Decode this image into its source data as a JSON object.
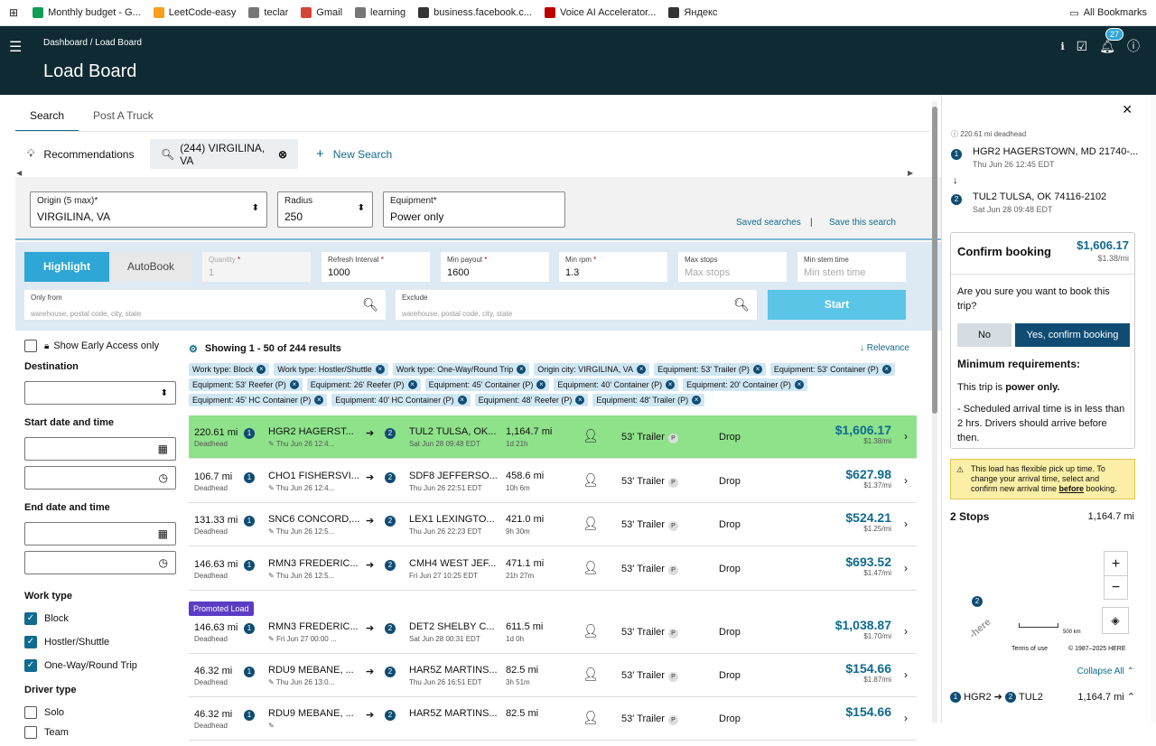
{
  "bookmarks": {
    "items": [
      {
        "label": "Monthly budget - G...",
        "icon": "sheets-icon",
        "color": "#0f9d58"
      },
      {
        "label": "LeetCode-easy",
        "icon": "leetcode-icon",
        "color": "#f89f1b"
      },
      {
        "label": "teclar",
        "icon": "folder-icon",
        "color": "#777"
      },
      {
        "label": "Gmail",
        "icon": "gmail-icon",
        "color": "#d44638"
      },
      {
        "label": "learning",
        "icon": "folder-icon",
        "color": "#777"
      },
      {
        "label": "business.facebook.c...",
        "icon": "globe-icon",
        "color": "#333"
      },
      {
        "label": "Voice AI Accelerator...",
        "icon": "sk-icon",
        "color": "#b00"
      },
      {
        "label": "Яндекс",
        "icon": "globe-icon",
        "color": "#333"
      }
    ],
    "all": "All Bookmarks"
  },
  "header": {
    "breadcrumb": "Dashboard / Load Board",
    "title": "Load Board",
    "notif_count": "27"
  },
  "tabs": [
    "Search",
    "Post A Truck"
  ],
  "searchbar": {
    "recommendations": "Recommendations",
    "current": "(244) VIRGILINA, VA",
    "new_search": "New Search"
  },
  "form": {
    "origin_label": "Origin (5 max)*",
    "origin_value": "VIRGILINA, VA",
    "radius_label": "Radius",
    "radius_value": "250",
    "equip_label": "Equipment*",
    "equip_value": "Power only",
    "saved": "Saved searches",
    "sep": "|",
    "save_this": "Save this search"
  },
  "options": {
    "highlight": "Highlight",
    "autobook": "AutoBook",
    "quantity_label": "Quantity",
    "quantity_value": "1",
    "refresh_label": "Refresh Interval",
    "refresh_value": "1000",
    "minpay_label": "Min payout",
    "minpay_value": "1600",
    "minrpm_label": "Min rpm",
    "minrpm_value": "1.3",
    "maxstops_label": "Max stops",
    "maxstops_ph": "Max stops",
    "minstem_label": "Min stem time",
    "minstem_ph": "Min stem time",
    "onlyfrom_label": "Only from",
    "onlyfrom_ph": "warehouse, postal code, city, state",
    "exclude_label": "Exclude",
    "exclude_ph": "warehouse, postal code, city, state",
    "start": "Start",
    "req": "*"
  },
  "filters": {
    "early_access": "Show Early Access only",
    "destination": "Destination",
    "start_dt": "Start date and time",
    "end_dt": "End date and time",
    "work_type": "Work type",
    "work_items": [
      "Block",
      "Hostler/Shuttle",
      "One-Way/Round Trip"
    ],
    "driver_type": "Driver type",
    "driver_items": [
      "Solo",
      "Team"
    ]
  },
  "results": {
    "showing": "Showing 1 - 50 of 244 results",
    "sort": "Relevance",
    "chips": [
      "Work type: Block",
      "Work type: Hostler/Shuttle",
      "Work type: One-Way/Round Trip",
      "Origin city: VIRGILINA, VA",
      "Equipment: 53' Trailer (P)",
      "Equipment: 53' Container (P)",
      "Equipment: 53' Reefer (P)",
      "Equipment: 26' Reefer (P)",
      "Equipment: 45' Container (P)",
      "Equipment: 40' Container (P)",
      "Equipment: 20' Container (P)",
      "Equipment: 45' HC Container (P)",
      "Equipment: 40' HC Container (P)",
      "Equipment: 48' Reefer (P)",
      "Equipment: 48' Trailer (P)"
    ],
    "promoted": "Promoted Load",
    "deadhead": "Deadhead",
    "rows": [
      {
        "dh": "220.61 mi",
        "from": "HGR2 HAGERST...",
        "ft": "Thu Jun 26 12:4...",
        "to": "TUL2 TULSA, OK...",
        "tt": "Sat Jun 28 09:48 EDT",
        "dist": "1,164.7 mi",
        "dur": "1d 21h",
        "eq": "53' Trailer",
        "type": "Drop",
        "pay": "$1,606.17",
        "rate": "$1.38/mi"
      },
      {
        "dh": "106.7 mi",
        "from": "CHO1 FISHERSVI...",
        "ft": "Thu Jun 26 12:4...",
        "to": "SDF8 JEFFERSO...",
        "tt": "Thu Jun 26 22:51 EDT",
        "dist": "458.6 mi",
        "dur": "10h 6m",
        "eq": "53' Trailer",
        "type": "Drop",
        "pay": "$627.98",
        "rate": "$1.37/mi"
      },
      {
        "dh": "131.33 mi",
        "from": "SNC6 CONCORD,...",
        "ft": "Thu Jun 26 12:5...",
        "to": "LEX1 LEXINGTO...",
        "tt": "Thu Jun 26 22:23 EDT",
        "dist": "421.0 mi",
        "dur": "9h 30m",
        "eq": "53' Trailer",
        "type": "Drop",
        "pay": "$524.21",
        "rate": "$1.25/mi"
      },
      {
        "dh": "146.63 mi",
        "from": "RMN3 FREDERIC...",
        "ft": "Thu Jun 26 12:5...",
        "to": "CMH4 WEST JEF...",
        "tt": "Fri Jun 27 10:25 EDT",
        "dist": "471.1 mi",
        "dur": "21h 27m",
        "eq": "53' Trailer",
        "type": "Drop",
        "pay": "$693.52",
        "rate": "$1.47/mi"
      },
      {
        "dh": "146.63 mi",
        "from": "RMN3 FREDERIC...",
        "ft": "Fri Jun 27 00:00 ...",
        "to": "DET2 SHELBY C...",
        "tt": "Sat Jun 28 00:31 EDT",
        "dist": "611.5 mi",
        "dur": "1d 0h",
        "eq": "53' Trailer",
        "type": "Drop",
        "pay": "$1,038.87",
        "rate": "$1.70/mi"
      },
      {
        "dh": "46.32 mi",
        "from": "RDU9 MEBANE, ...",
        "ft": "Thu Jun 26 13:0...",
        "to": "HAR5Z MARTINS...",
        "tt": "Thu Jun 26 16:51 EDT",
        "dist": "82.5 mi",
        "dur": "3h 51m",
        "eq": "53' Trailer",
        "type": "Drop",
        "pay": "$154.66",
        "rate": "$1.87/mi"
      },
      {
        "dh": "46.32 mi",
        "from": "RDU9 MEBANE, ...",
        "ft": "",
        "to": "HAR5Z MARTINS...",
        "tt": "",
        "dist": "82.5 mi",
        "dur": "",
        "eq": "53' Trailer",
        "type": "Drop",
        "pay": "$154.66",
        "rate": ""
      }
    ]
  },
  "side": {
    "deadhead": "220.61 mi deadhead",
    "stop1": "HGR2 HAGERSTOWN, MD 21740-...",
    "stop1_time": "Thu Jun 26 12:45 EDT",
    "stop2": "TUL2 TULSA, OK 74116-2102",
    "stop2_time": "Sat Jun 28 09:48 EDT",
    "confirm_title": "Confirm booking",
    "price": "$1,606.17",
    "rate": "$1.38/mi",
    "question": "Are you sure you want to book this trip?",
    "no": "No",
    "yes": "Yes, confirm booking",
    "min_req": "Minimum requirements:",
    "req1_pre": "This trip is ",
    "req1_bold": "power only.",
    "req2": "- Scheduled arrival time is in less than 2 hrs. Drivers should arrive before then.",
    "warn_pre": "This load has flexible pick up time. To change your arrival time, select and confirm new arrival time ",
    "warn_bold": "before",
    "warn_post": " booking.",
    "stops": "2 Stops",
    "stops_dist": "1,164.7 mi",
    "map_stop": "2",
    "scale": "500 km",
    "terms": "Terms of use",
    "copy": "© 1987–2025 HERE",
    "here": "here",
    "collapse": "Collapse All",
    "leg_from": "HGR2",
    "leg_to": "TUL2",
    "leg_dist": "1,164.7 mi"
  }
}
